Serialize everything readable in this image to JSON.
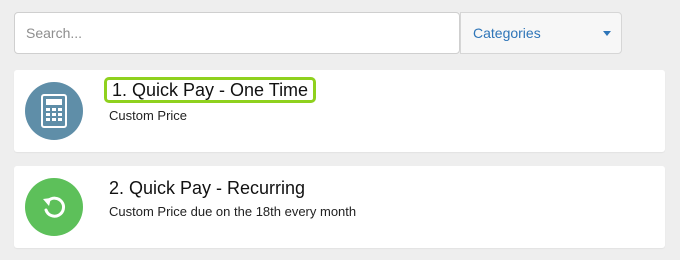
{
  "search": {
    "placeholder": "Search...",
    "value": ""
  },
  "categories_dropdown": {
    "label": "Categories"
  },
  "items": [
    {
      "title": "1. Quick Pay - One Time",
      "subtitle": "Custom Price",
      "icon": "calculator-icon",
      "icon_color": "#5f8ea8"
    },
    {
      "title": "2. Quick Pay - Recurring",
      "subtitle": "Custom Price due on the 18th every month",
      "icon": "recurring-arrow-icon",
      "icon_color": "#5dc05a"
    }
  ],
  "colors": {
    "accent": "#2e75b8",
    "highlight": "#8fd11e"
  }
}
